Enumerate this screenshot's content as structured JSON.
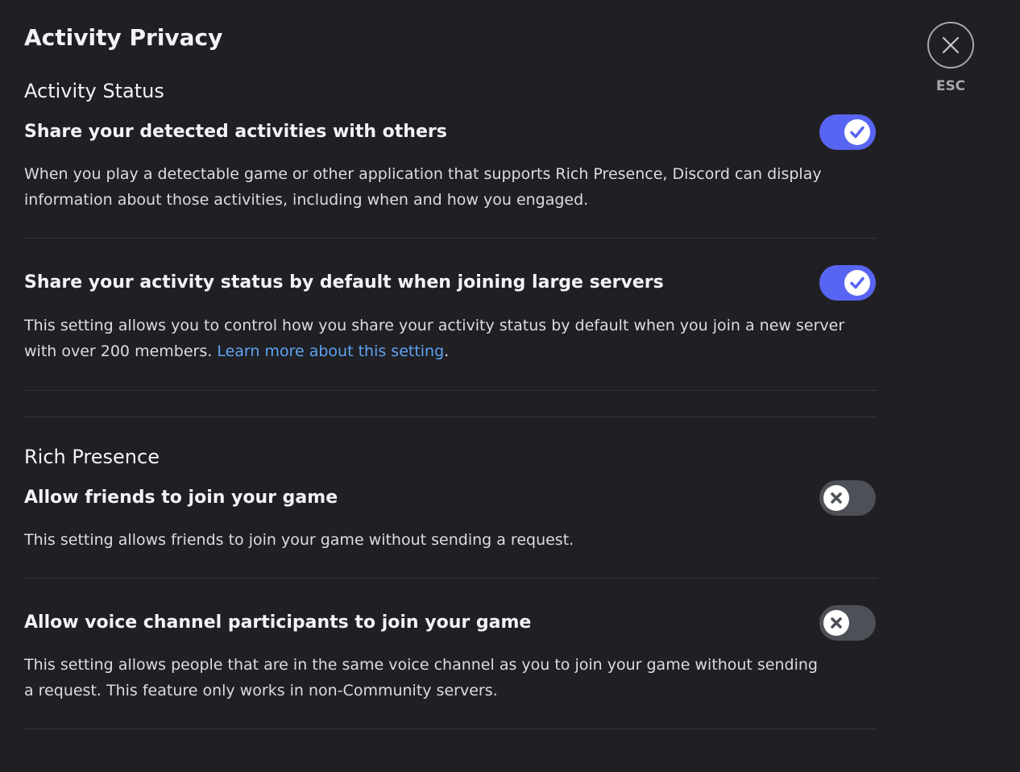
{
  "page": {
    "title": "Activity Privacy"
  },
  "close": {
    "esc_label": "ESC"
  },
  "sections": {
    "activity_status": {
      "heading": "Activity Status",
      "settings": [
        {
          "title": "Share your detected activities with others",
          "description": "When you play a detectable game or other application that supports Rich Presence, Discord can display information about those activities, including when and how you engaged.",
          "enabled": true
        },
        {
          "title": "Share your activity status by default when joining large servers",
          "description": "This setting allows you to control how you share your activity status by default when you join a new server with over 200 members.",
          "link_text": "Learn more about this setting",
          "trailing": ".",
          "enabled": true
        }
      ]
    },
    "rich_presence": {
      "heading": "Rich Presence",
      "settings": [
        {
          "title": "Allow friends to join your game",
          "description": "This setting allows friends to join your game without sending a request.",
          "enabled": false
        },
        {
          "title": "Allow voice channel participants to join your game",
          "description": "This setting allows people that are in the same voice channel as you to join your game without sending a request. This feature only works in non-Community servers.",
          "enabled": false
        }
      ]
    }
  },
  "colors": {
    "background": "#1f1f24",
    "toggle_on": "#5865f2",
    "toggle_off": "#4e5058",
    "link": "#5fa3f0"
  },
  "icons": {
    "close": "close-icon",
    "check": "check-icon",
    "x": "x-icon"
  }
}
